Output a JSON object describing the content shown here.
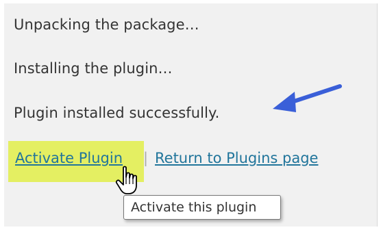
{
  "messages": [
    "Unpacking the package…",
    "Installing the plugin…",
    "Plugin installed successfully."
  ],
  "actions": {
    "activate_label": "Activate Plugin",
    "separator": "|",
    "return_label": "Return to Plugins page"
  },
  "tooltip": "Activate this plugin",
  "icons": {
    "annotation_arrow": "blue-arrow-icon",
    "cursor": "hand-pointer-icon"
  },
  "colors": {
    "panel_background": "#f1f1f1",
    "link": "#21759b",
    "highlight": "#e4ef62",
    "arrow": "#3a5fd8"
  }
}
